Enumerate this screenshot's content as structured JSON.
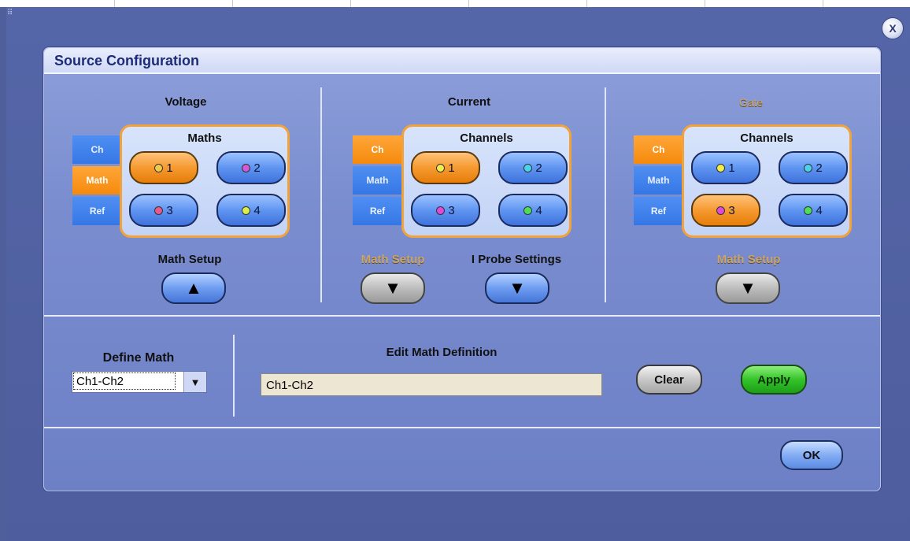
{
  "window": {
    "close_label": "X"
  },
  "dialog": {
    "title": "Source Configuration"
  },
  "colors": {
    "accent_orange": "#f58a0c",
    "tab_blue": "#3577e6",
    "apply_green": "#34c32a",
    "dialog_blue": "#7a8dcf"
  },
  "voltage": {
    "header": "Voltage",
    "tabs": [
      "Ch",
      "Math",
      "Ref"
    ],
    "selected_tab": "Math",
    "box_title": "Maths",
    "buttons": [
      {
        "label": "1",
        "dot_color": "#f2c94c",
        "selected": true
      },
      {
        "label": "2",
        "dot_color": "#d15ad6",
        "selected": false
      },
      {
        "label": "3",
        "dot_color": "#e65a8c",
        "selected": false
      },
      {
        "label": "4",
        "dot_color": "#d9ef4a",
        "selected": false
      }
    ],
    "setup_label": "Math Setup",
    "setup_arrow": "▲"
  },
  "current": {
    "header": "Current",
    "tabs": [
      "Ch",
      "Math",
      "Ref"
    ],
    "selected_tab": "Ch",
    "box_title": "Channels",
    "buttons": [
      {
        "label": "1",
        "dot_color": "#f2ec4c",
        "selected": true
      },
      {
        "label": "2",
        "dot_color": "#4cd3ec",
        "selected": false
      },
      {
        "label": "3",
        "dot_color": "#e04ad9",
        "selected": false
      },
      {
        "label": "4",
        "dot_color": "#4cdf5a",
        "selected": false
      }
    ],
    "setup_label": "Math Setup",
    "setup_arrow": "▼",
    "probe_label": "I Probe Settings",
    "probe_arrow": "▼"
  },
  "gate": {
    "header": "Gate",
    "tabs": [
      "Ch",
      "Math",
      "Ref"
    ],
    "selected_tab": "Ch",
    "box_title": "Channels",
    "buttons": [
      {
        "label": "1",
        "dot_color": "#f2ec4c",
        "selected": false
      },
      {
        "label": "2",
        "dot_color": "#4cd3ec",
        "selected": false
      },
      {
        "label": "3",
        "dot_color": "#e04ad9",
        "selected": true
      },
      {
        "label": "4",
        "dot_color": "#4cdf5a",
        "selected": false
      }
    ],
    "setup_label": "Math Setup",
    "setup_arrow": "▼"
  },
  "define_math": {
    "label": "Define Math",
    "selected_value": "Ch1-Ch2",
    "dropdown_arrow": "▼"
  },
  "edit_math": {
    "label": "Edit Math Definition",
    "value": "Ch1-Ch2"
  },
  "actions": {
    "clear_label": "Clear",
    "apply_label": "Apply",
    "ok_label": "OK"
  },
  "corner_glyph": "⠿"
}
